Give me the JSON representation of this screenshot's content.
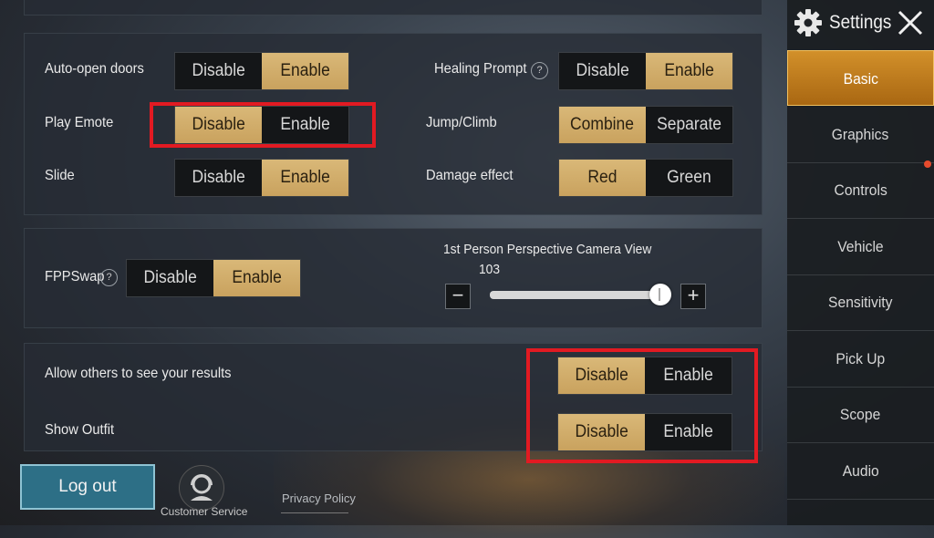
{
  "header": {
    "title": "Settings"
  },
  "sidebar": {
    "items": [
      {
        "label": "Basic",
        "active": true
      },
      {
        "label": "Graphics"
      },
      {
        "label": "Controls"
      },
      {
        "label": "Vehicle"
      },
      {
        "label": "Sensitivity"
      },
      {
        "label": "Pick Up"
      },
      {
        "label": "Scope"
      },
      {
        "label": "Audio"
      }
    ]
  },
  "settings": {
    "auto_open_doors": {
      "label": "Auto-open doors",
      "options": [
        "Disable",
        "Enable"
      ],
      "selected": "Enable"
    },
    "play_emote": {
      "label": "Play Emote",
      "options": [
        "Disable",
        "Enable"
      ],
      "selected": "Disable"
    },
    "slide": {
      "label": "Slide",
      "options": [
        "Disable",
        "Enable"
      ],
      "selected": "Enable"
    },
    "healing_prompt": {
      "label": "Healing Prompt",
      "options": [
        "Disable",
        "Enable"
      ],
      "selected": "Enable"
    },
    "jump_climb": {
      "label": "Jump/Climb",
      "options": [
        "Combine",
        "Separate"
      ],
      "selected": "Combine"
    },
    "damage_effect": {
      "label": "Damage effect",
      "options": [
        "Red",
        "Green"
      ],
      "selected": "Red"
    },
    "fpp_swap": {
      "label": "FPPSwap",
      "options": [
        "Disable",
        "Enable"
      ],
      "selected": "Enable"
    },
    "fpp_camera": {
      "label": "1st Person Perspective Camera View",
      "value": "103",
      "minus": "−",
      "plus": "+",
      "level": 1.0
    },
    "allow_results": {
      "label": "Allow others to see your results",
      "options": [
        "Disable",
        "Enable"
      ],
      "selected": "Disable"
    },
    "show_outfit": {
      "label": "Show Outfit",
      "options": [
        "Disable",
        "Enable"
      ],
      "selected": "Disable"
    }
  },
  "help_glyph": "?",
  "footer": {
    "logout": "Log out",
    "customer_service": "Customer Service",
    "privacy_policy": "Privacy Policy"
  },
  "colors": {
    "selected_option": "#c9a25e",
    "active_tab": "#c07d1e",
    "highlight_box": "#e21a22",
    "logout_button": "#2d6f86"
  }
}
